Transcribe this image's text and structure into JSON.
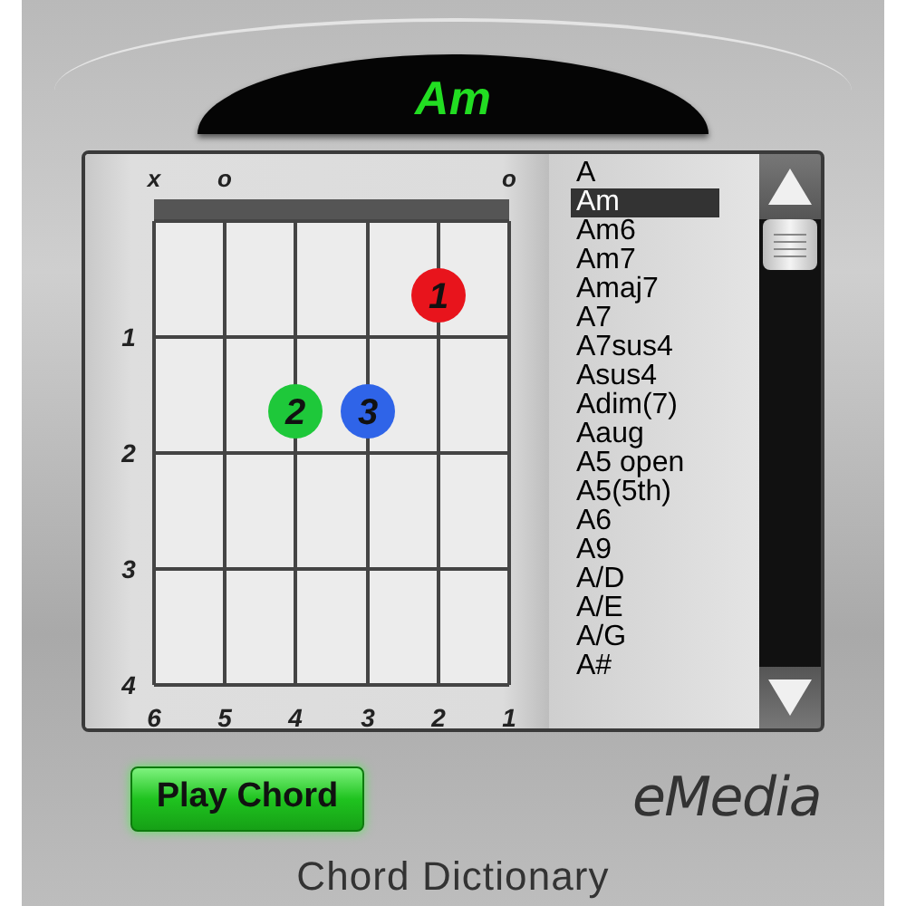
{
  "display": {
    "chord": "Am"
  },
  "diagram": {
    "strings": [
      {
        "number": "6",
        "mark": "x"
      },
      {
        "number": "5",
        "mark": "o"
      },
      {
        "number": "4"
      },
      {
        "number": "3"
      },
      {
        "number": "2"
      },
      {
        "number": "1",
        "mark": "o"
      }
    ],
    "frets": [
      {
        "label": "1",
        "cells": [
          {
            "dot": false
          },
          {
            "dot": false
          },
          {
            "dot": false
          },
          {
            "dot": false
          },
          {
            "dot": true,
            "finger": "1",
            "color": "#e8141c"
          },
          {
            "dot": false
          }
        ]
      },
      {
        "label": "2",
        "cells": [
          {
            "dot": false
          },
          {
            "dot": false
          },
          {
            "dot": true,
            "finger": "2",
            "color": "#1ec83a"
          },
          {
            "dot": true,
            "finger": "3",
            "color": "#2f64e8"
          },
          {
            "dot": false
          },
          {
            "dot": false
          }
        ]
      },
      {
        "label": "3",
        "cells": [
          {
            "dot": false
          },
          {
            "dot": false
          },
          {
            "dot": false
          },
          {
            "dot": false
          },
          {
            "dot": false
          },
          {
            "dot": false
          }
        ]
      },
      {
        "label": "4",
        "cells": [
          {
            "dot": false
          },
          {
            "dot": false
          },
          {
            "dot": false
          },
          {
            "dot": false
          },
          {
            "dot": false
          },
          {
            "dot": false
          }
        ]
      }
    ]
  },
  "chord_list": [
    {
      "label": "A",
      "selected": false
    },
    {
      "label": "Am",
      "selected": true
    },
    {
      "label": "Am6",
      "selected": false
    },
    {
      "label": "Am7",
      "selected": false
    },
    {
      "label": "Amaj7",
      "selected": false
    },
    {
      "label": "A7",
      "selected": false
    },
    {
      "label": "A7sus4",
      "selected": false
    },
    {
      "label": "Asus4",
      "selected": false
    },
    {
      "label": "Adim(7)",
      "selected": false
    },
    {
      "label": "Aaug",
      "selected": false
    },
    {
      "label": "A5 open",
      "selected": false
    },
    {
      "label": "A5(5th)",
      "selected": false
    },
    {
      "label": "A6",
      "selected": false
    },
    {
      "label": "A9",
      "selected": false
    },
    {
      "label": "A/D",
      "selected": false
    },
    {
      "label": "A/E",
      "selected": false
    },
    {
      "label": "A/G",
      "selected": false
    },
    {
      "label": "A#",
      "selected": false
    }
  ],
  "play_button": "Play Chord",
  "logo": "eMedia",
  "footer_title": "Chord Dictionary"
}
